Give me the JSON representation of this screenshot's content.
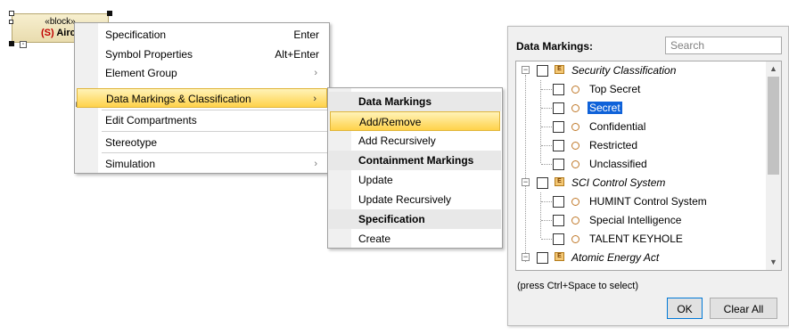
{
  "block": {
    "stereotype": "«block»",
    "flag": "(S)",
    "name": "Aircr"
  },
  "context_menu": {
    "items": [
      {
        "label": "Specification",
        "shortcut": "Enter"
      },
      {
        "label": "Symbol Properties",
        "shortcut": "Alt+Enter"
      },
      {
        "label": "Element Group",
        "arrow": "›"
      },
      {
        "label": "Data Markings & Classification",
        "arrow": "›"
      },
      {
        "label": "Edit Compartments"
      },
      {
        "label": "Stereotype"
      },
      {
        "label": "Simulation",
        "arrow": "›"
      }
    ]
  },
  "submenu": {
    "sections": [
      {
        "header": "Data Markings",
        "items": [
          "Add/Remove",
          "Add Recursively"
        ]
      },
      {
        "header": "Containment Markings",
        "items": [
          "Update",
          "Update Recursively"
        ]
      },
      {
        "header": "Specification",
        "items": [
          "Create"
        ]
      }
    ]
  },
  "panel": {
    "title": "Data Markings:",
    "search_placeholder": "Search",
    "tree": [
      {
        "label": "Security Classification",
        "type": "enumeration",
        "expander": "−"
      },
      {
        "label": "Top Secret",
        "type": "literal"
      },
      {
        "label": "Secret",
        "type": "literal",
        "selected": true
      },
      {
        "label": "Confidential",
        "type": "literal"
      },
      {
        "label": "Restricted",
        "type": "literal"
      },
      {
        "label": "Unclassified",
        "type": "literal"
      },
      {
        "label": "SCI Control System",
        "type": "enumeration",
        "expander": "−"
      },
      {
        "label": "HUMINT Control System",
        "type": "literal"
      },
      {
        "label": "Special Intelligence",
        "type": "literal"
      },
      {
        "label": "TALENT KEYHOLE",
        "type": "literal"
      },
      {
        "label": "Atomic Energy Act",
        "type": "enumeration",
        "expander": "−"
      }
    ],
    "enum_icon": "E",
    "hint": "(press Ctrl+Space to select)",
    "ok_label": "OK",
    "clear_label": "Clear All"
  },
  "colors": {
    "highlight": "#ffd24a",
    "selection": "#0f62d9",
    "block_fill": "#f2e8c4"
  }
}
